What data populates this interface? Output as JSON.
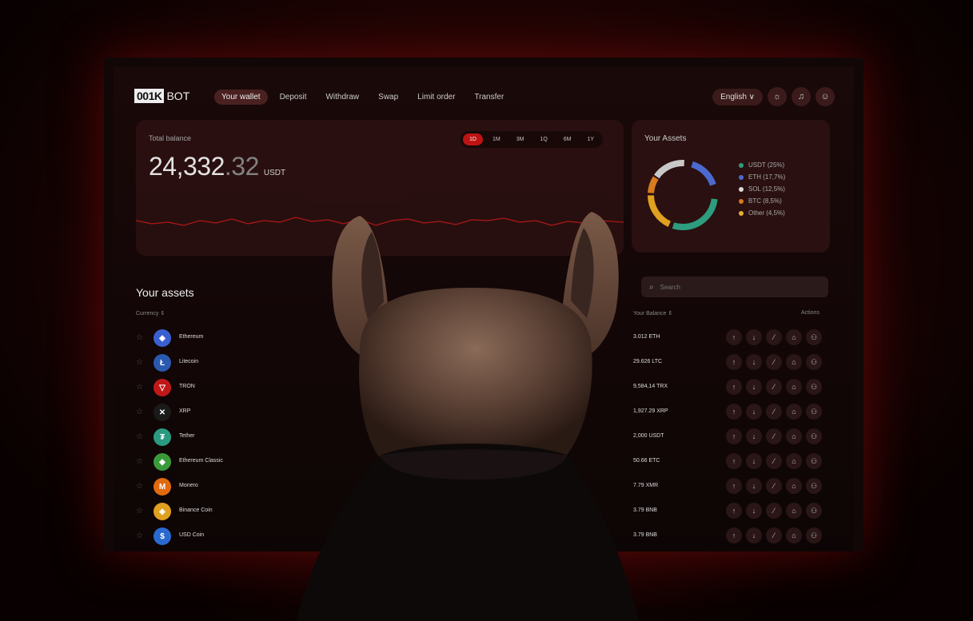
{
  "brand": {
    "logo_box": "001K",
    "logo_text": "BOT"
  },
  "nav": {
    "items": [
      {
        "label": "Your wallet",
        "active": true
      },
      {
        "label": "Deposit",
        "active": false
      },
      {
        "label": "Withdraw",
        "active": false
      },
      {
        "label": "Swap",
        "active": false
      },
      {
        "label": "Limit order",
        "active": false
      },
      {
        "label": "Transfer",
        "active": false
      }
    ]
  },
  "topbar": {
    "language": "English ∨",
    "icons": [
      "sun-icon",
      "bell-icon",
      "user-icon"
    ]
  },
  "balance": {
    "label": "Total balance",
    "value_int": "24,332",
    "value_dec": ".32",
    "unit": "USDT",
    "periods": [
      {
        "label": "1D",
        "active": true
      },
      {
        "label": "1M",
        "active": false
      },
      {
        "label": "3M",
        "active": false
      },
      {
        "label": "1Q",
        "active": false
      },
      {
        "label": "6M",
        "active": false
      },
      {
        "label": "1Y",
        "active": false
      }
    ]
  },
  "assets_summary": {
    "title": "Your Assets",
    "legend": [
      {
        "label": "USDT (25%)",
        "color": "#2e9c7e",
        "pct": 25
      },
      {
        "label": "ETH (17,7%)",
        "color": "#4a6ad0",
        "pct": 17.7
      },
      {
        "label": "SOL (12,5%)",
        "color": "#d8d8d8",
        "pct": 12.5
      },
      {
        "label": "BTC (8,5%)",
        "color": "#d87a20",
        "pct": 8.5
      },
      {
        "label": "Other (4,5%)",
        "color": "#e0b030",
        "pct": 4.5
      }
    ]
  },
  "table": {
    "heading": "Your assets",
    "col_currency": "Currency ⇕",
    "col_balance": "Your Balance ⇕",
    "col_actions": "Actions",
    "search_placeholder": "Search",
    "rows": [
      {
        "name": "Ethereum",
        "balance": "3.012 ETH",
        "color": "#3a5fd0",
        "glyph": "◆"
      },
      {
        "name": "Litecoin",
        "balance": "29.626 LTC",
        "color": "#2a5ab0",
        "glyph": "Ł"
      },
      {
        "name": "TRON",
        "balance": "9,584,14 TRX",
        "color": "#c01818",
        "glyph": "▽"
      },
      {
        "name": "XRP",
        "balance": "1,927.29 XRP",
        "color": "#1a1a1a",
        "glyph": "✕"
      },
      {
        "name": "Tether",
        "balance": "2,000 USDT",
        "color": "#2a9a80",
        "glyph": "₮"
      },
      {
        "name": "Ethereum Classic",
        "balance": "50.66 ETC",
        "color": "#3a9a3a",
        "glyph": "◆"
      },
      {
        "name": "Monero",
        "balance": "7.79 XMR",
        "color": "#e06a10",
        "glyph": "M"
      },
      {
        "name": "Binance Coin",
        "balance": "3.79 BNB",
        "color": "#e0a020",
        "glyph": "◈"
      },
      {
        "name": "USD Coin",
        "balance": "3.79 BNB",
        "color": "#2a6ad0",
        "glyph": "$"
      }
    ],
    "action_icons": [
      "↑",
      "↓",
      "⁄",
      "⌂",
      "⚇"
    ]
  }
}
